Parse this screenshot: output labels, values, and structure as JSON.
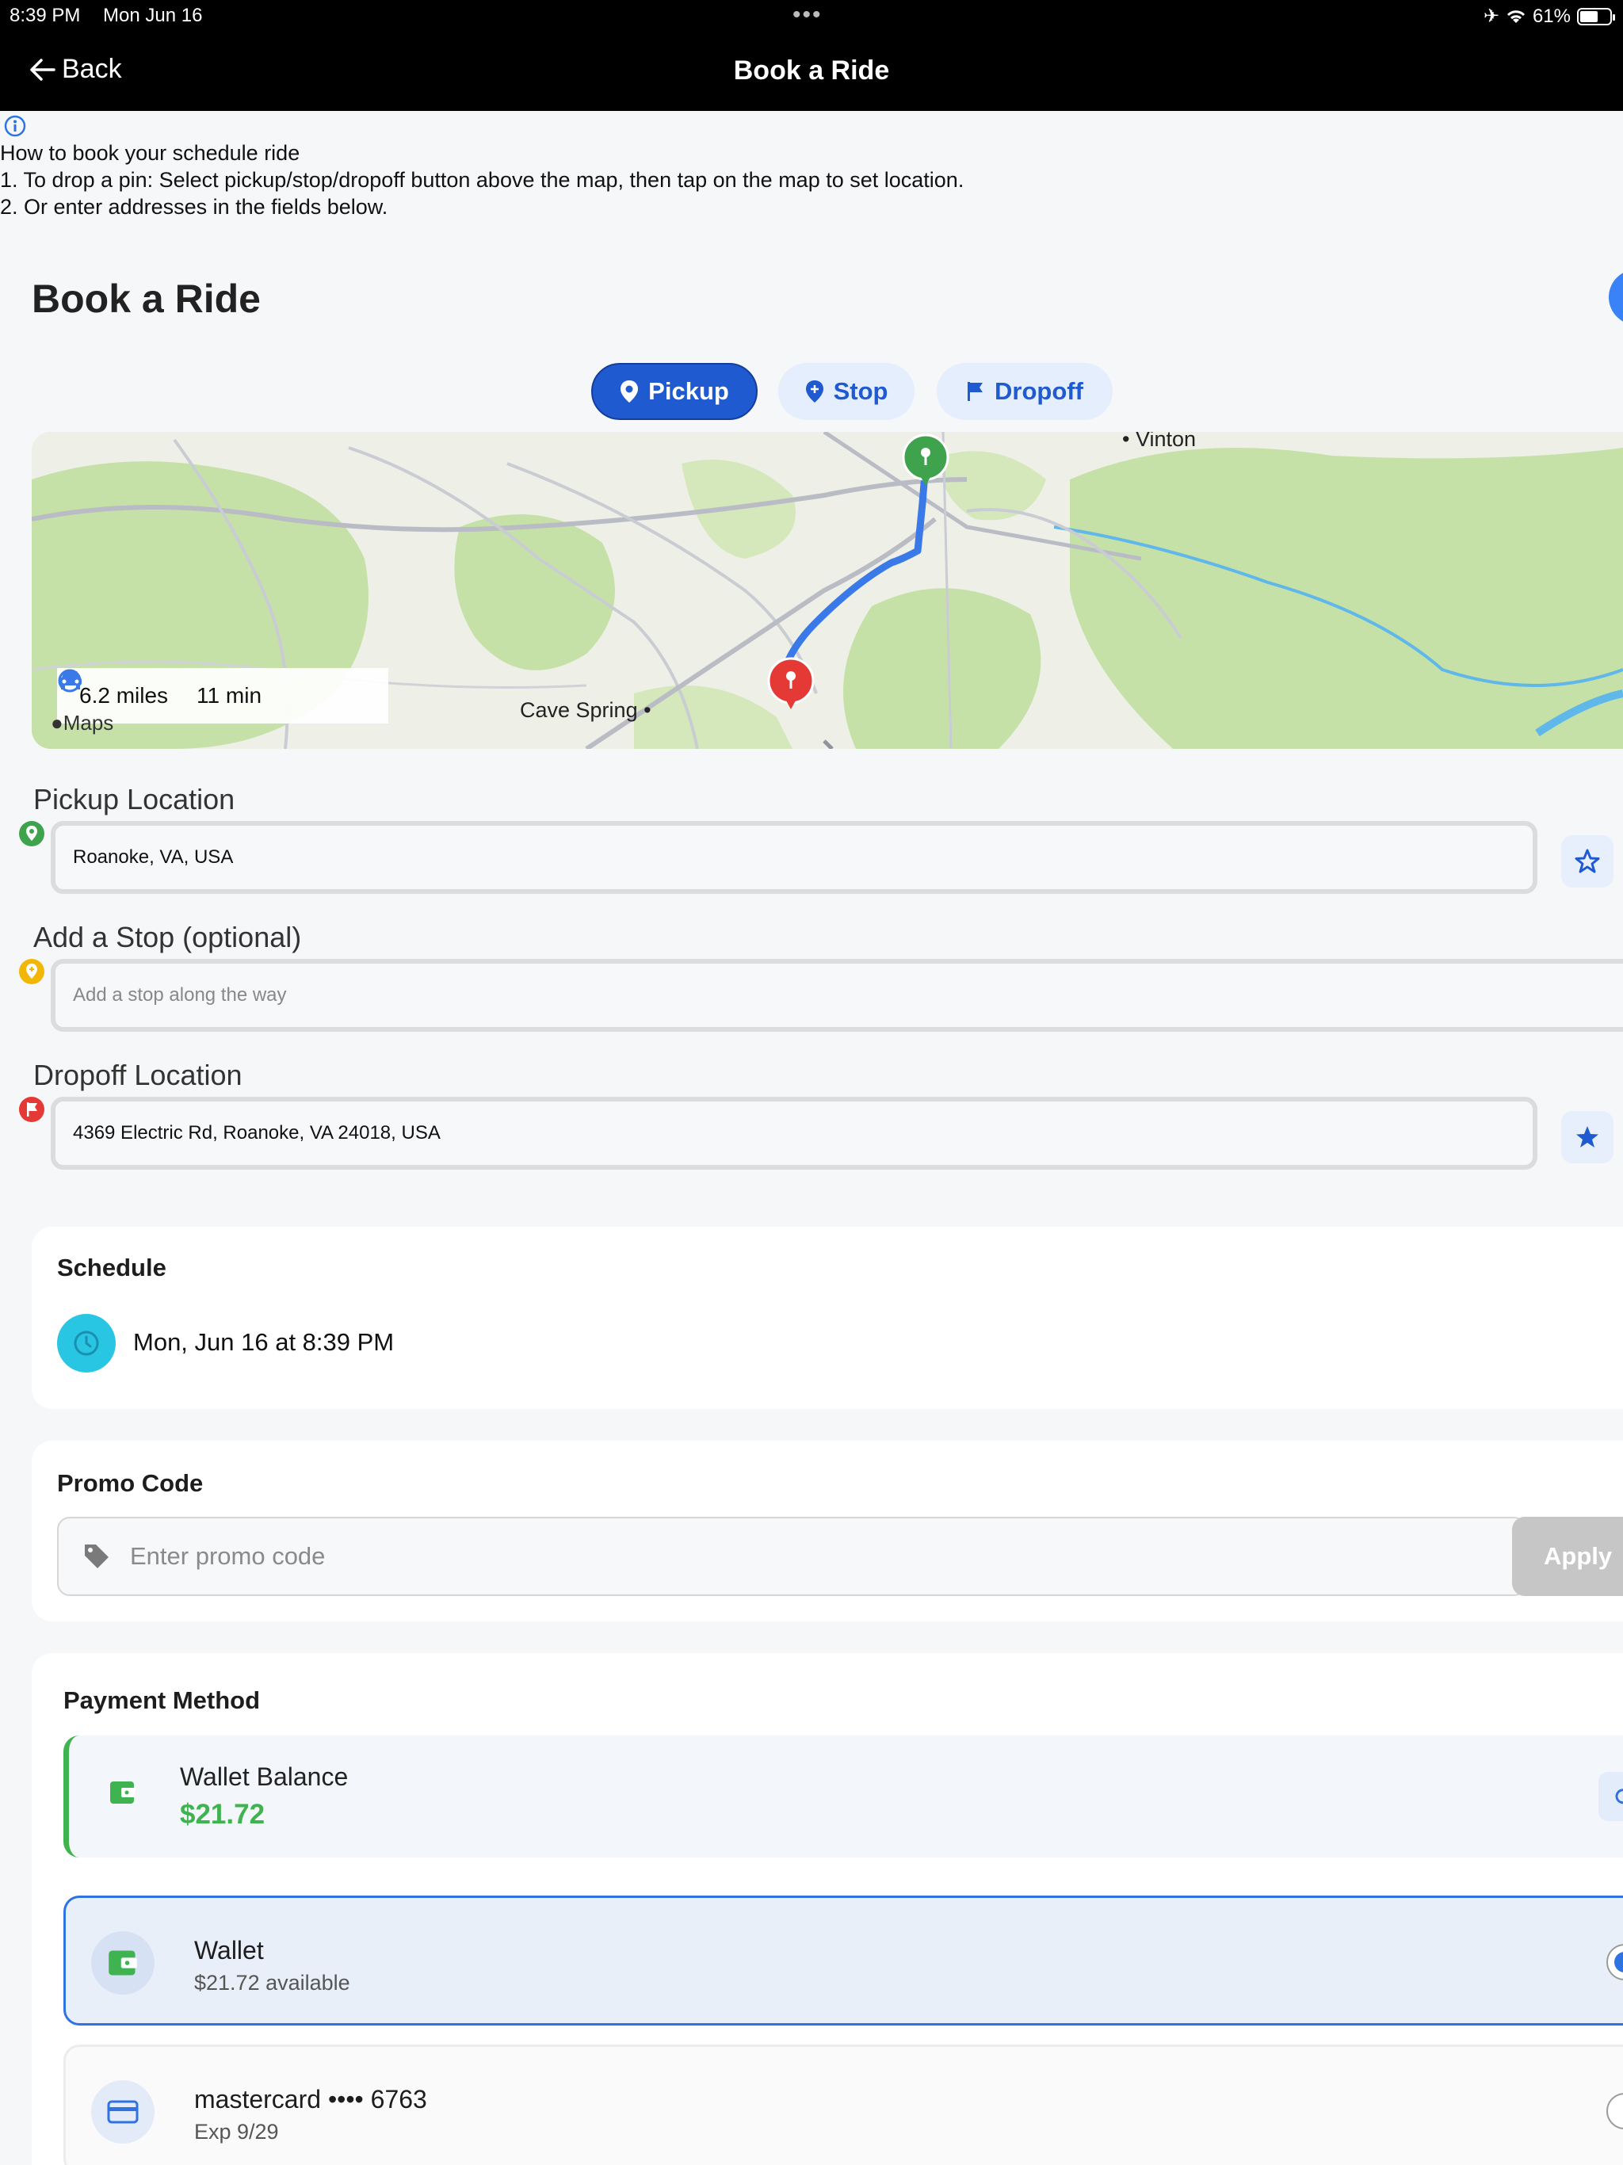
{
  "status_bar": {
    "time": "8:39 PM",
    "date": "Mon Jun 16",
    "battery": "61%"
  },
  "nav": {
    "back_label": "Back",
    "title": "Book a Ride"
  },
  "instructions": {
    "heading": "How to book your schedule ride",
    "step1": "1. To drop a pin: Select pickup/stop/dropoff button above the map, then tap on the map to set location.",
    "step2": "2. Or enter addresses in the fields below."
  },
  "page_title": "Book a Ride",
  "modes": {
    "pickup": "Pickup",
    "stop": "Stop",
    "dropoff": "Dropoff",
    "active": "pickup"
  },
  "map": {
    "distance": "6.2 miles",
    "duration": "11 min",
    "label_vinton": "Vinton",
    "label_cave_spring": "Cave Spring",
    "attribution": "Maps"
  },
  "pickup": {
    "label": "Pickup Location",
    "value": "Roanoke, VA, USA"
  },
  "stop": {
    "label": "Add a Stop (optional)",
    "placeholder": "Add a stop along the way"
  },
  "dropoff": {
    "label": "Dropoff Location",
    "value": "4369 Electric Rd, Roanoke, VA 24018, USA"
  },
  "schedule": {
    "title": "Schedule",
    "value": "Mon, Jun 16 at 8:39 PM"
  },
  "promo": {
    "title": "Promo Code",
    "placeholder": "Enter promo code",
    "apply_label": "Apply"
  },
  "payment": {
    "title": "Payment Method",
    "wallet_balance_label": "Wallet Balance",
    "wallet_balance_amount": "$21.72",
    "options": [
      {
        "name": "Wallet",
        "detail": "$21.72 available",
        "selected": true
      },
      {
        "name": "mastercard •••• 6763",
        "detail": "Exp 9/29",
        "selected": false
      }
    ]
  },
  "colors": {
    "primary": "#1f5ad1",
    "pickup_pin": "#3fa34d",
    "stop_pin": "#f2b705",
    "dropoff_pin": "#e53935",
    "wallet_green": "#3fb34f"
  }
}
